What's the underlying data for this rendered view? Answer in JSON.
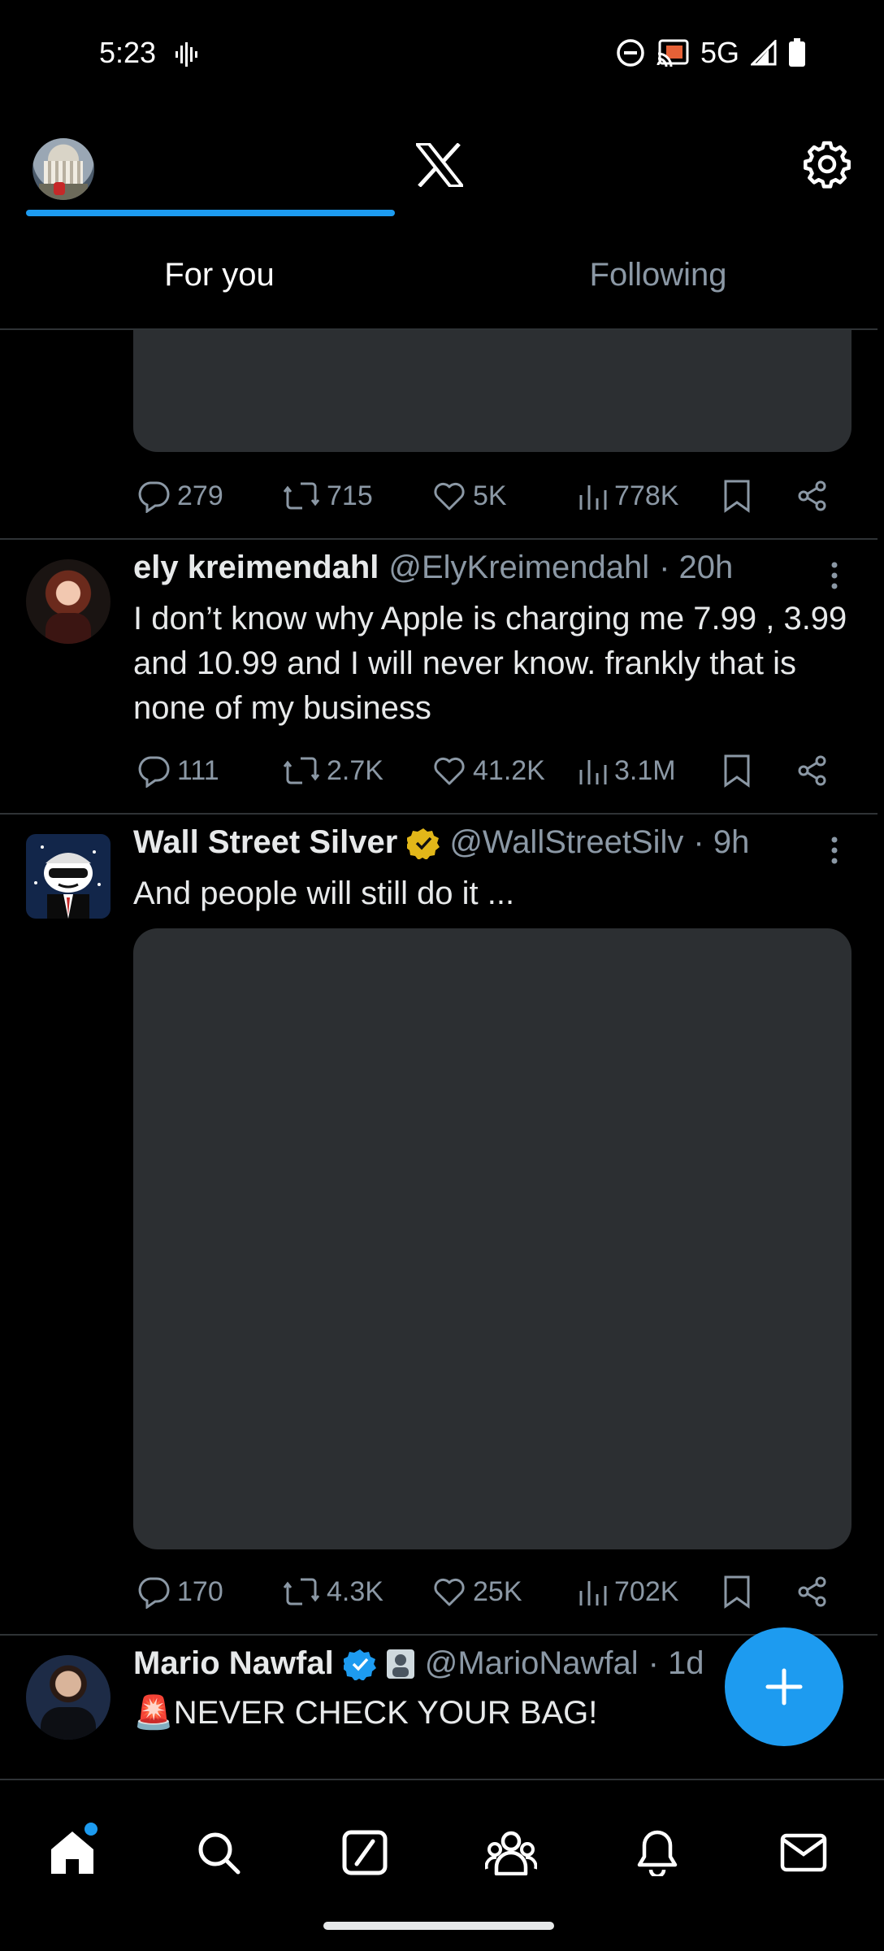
{
  "status_bar": {
    "time": "5:23",
    "network": "5G"
  },
  "header": {
    "tabs": [
      {
        "label": "For you",
        "selected": true
      },
      {
        "label": "Following",
        "selected": false
      }
    ]
  },
  "posts": [
    {
      "has_media": true,
      "stats": {
        "replies": "279",
        "reposts": "715",
        "likes": "5K",
        "views": "778K"
      }
    },
    {
      "name": "ely kreimendahl",
      "handle": "@ElyKreimendahl",
      "time": "· 20h",
      "text": "I don’t know why Apple is charging me 7.99 , 3.99 and 10.99 and I will never know. frankly that is none of my business",
      "stats": {
        "replies": "111",
        "reposts": "2.7K",
        "likes": "41.2K",
        "views": "3.1M"
      }
    },
    {
      "name": "Wall Street Silver",
      "verified": "gold",
      "handle": "@WallStreetSilv",
      "time": "· 9h",
      "text": "And people will still do it ...",
      "has_media": true,
      "stats": {
        "replies": "170",
        "reposts": "4.3K",
        "likes": "25K",
        "views": "702K"
      }
    },
    {
      "name": "Mario Nawfal",
      "verified": "blue",
      "handle": "@MarioNawfal",
      "time": "· 1d",
      "text": "🚨NEVER CHECK YOUR BAG!"
    }
  ],
  "colors": {
    "accent": "#1d9bf0",
    "background": "#000000",
    "text": "#e7e9ea",
    "muted": "#8b98a5",
    "media": "#2c2f32",
    "gold": "#e2b719"
  },
  "bottom_nav": [
    "home-icon",
    "search-icon",
    "grok-icon",
    "communities-icon",
    "notifications-icon",
    "messages-icon"
  ]
}
